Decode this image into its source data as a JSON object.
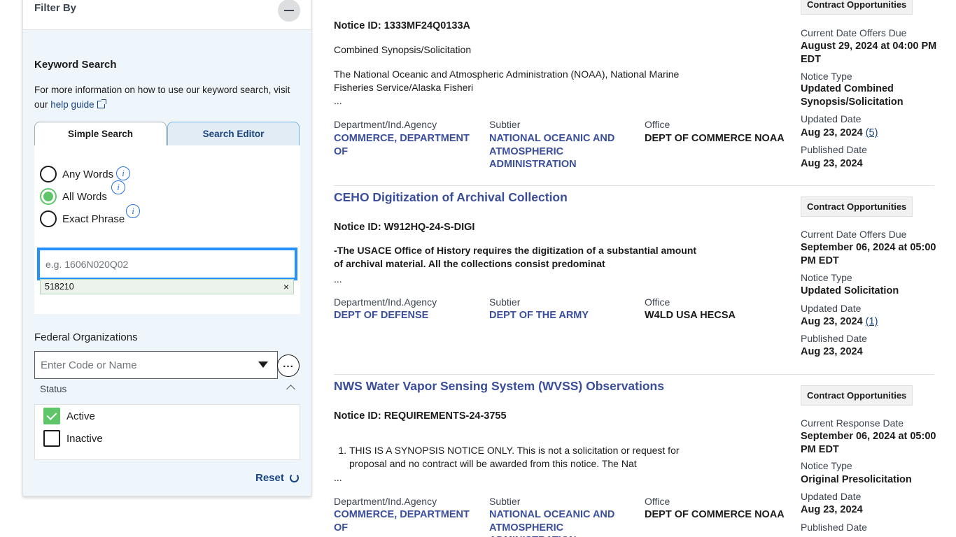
{
  "sidebar": {
    "filter_title": "Filter By",
    "keyword": {
      "title": "Keyword Search",
      "description": "For more information on how to use our keyword search, visit our",
      "help_link": "help guide",
      "tabs": [
        "Simple Search",
        "Search Editor"
      ],
      "options": [
        {
          "label": "Any Words",
          "checked": false
        },
        {
          "label": "All Words",
          "checked": true
        },
        {
          "label": "Exact Phrase",
          "checked": false
        }
      ],
      "input_placeholder": "e.g. 1606N020Q02",
      "input_value": "",
      "chip": "518210",
      "chip_remove": "×"
    },
    "federal": {
      "title": "Federal Organizations",
      "placeholder": "Enter Code or Name",
      "more_label": "..."
    },
    "status": {
      "label": "Status",
      "items": [
        {
          "label": "Active",
          "checked": true
        },
        {
          "label": "Inactive",
          "checked": false
        }
      ]
    },
    "reset_label": "Reset"
  },
  "results": [
    {
      "title": "",
      "tag": "Contract Opportunities",
      "notice_id": "Notice ID: 1333MF24Q0133A",
      "type_line": "Combined Synopsis/Solicitation",
      "description": "The National Oceanic and Atmospheric Administration (NOAA), National Marine Fisheries Service/Alaska Fisheri",
      "ellipsis": "...",
      "department_label": "Department/Ind.Agency",
      "department": "COMMERCE, DEPARTMENT OF",
      "subtier_label": "Subtier",
      "subtier": "NATIONAL OCEANIC AND ATMOSPHERIC ADMINISTRATION",
      "office_label": "Office",
      "office": "DEPT OF COMMERCE NOAA",
      "date_label": "Current Date Offers Due",
      "date_value": "August 29, 2024 at 04:00 PM EDT",
      "notice_type_label": "Notice Type",
      "notice_type": "Updated Combined Synopsis/Solicitation",
      "updated_label": "Updated Date",
      "updated_value": "Aug 23, 2024",
      "updated_count": "(5)",
      "published_label": "Published Date",
      "published_value": "Aug 23, 2024"
    },
    {
      "title": "CEHO Digitization of Archival Collection",
      "tag": "Contract Opportunities",
      "notice_id": "Notice ID: W912HQ-24-S-DIGI",
      "description": "-The USACE Office of History requires the digitization of a substantial amount of archival material. All the collections consist predominat",
      "ellipsis": "...",
      "department_label": "Department/Ind.Agency",
      "department": "DEPT OF DEFENSE",
      "subtier_label": "Subtier",
      "subtier": "DEPT OF THE ARMY",
      "office_label": "Office",
      "office": "W4LD USA HECSA",
      "date_label": "Current Date Offers Due",
      "date_value": "September 06, 2024 at 05:00 PM EDT",
      "notice_type_label": "Notice Type",
      "notice_type": "Updated Solicitation",
      "updated_label": "Updated Date",
      "updated_value": "Aug 23, 2024",
      "updated_count": "(1)",
      "published_label": "Published Date",
      "published_value": "Aug 23, 2024"
    },
    {
      "title": "NWS Water Vapor Sensing System (WVSS) Observations",
      "tag": "Contract Opportunities",
      "notice_id": "Notice ID: REQUIREMENTS-24-3755",
      "description": "THIS IS A SYNOPSIS NOTICE ONLY. This is not a solicitation or request for proposal and no contract will be awarded from this notice. The Nat",
      "ellipsis": "...",
      "department_label": "Department/Ind.Agency",
      "department": "COMMERCE, DEPARTMENT OF",
      "subtier_label": "Subtier",
      "subtier": "NATIONAL OCEANIC AND ATMOSPHERIC ADMINISTRATION",
      "office_label": "Office",
      "office": "DEPT OF COMMERCE NOAA",
      "date_label": "Current Response Date",
      "date_value": "September 06, 2024 at 05:00 PM EDT",
      "notice_type_label": "Notice Type",
      "notice_type": "Original Presolicitation",
      "updated_label": "Updated Date",
      "updated_value": "Aug 23, 2024",
      "published_label": "Published Date"
    }
  ]
}
